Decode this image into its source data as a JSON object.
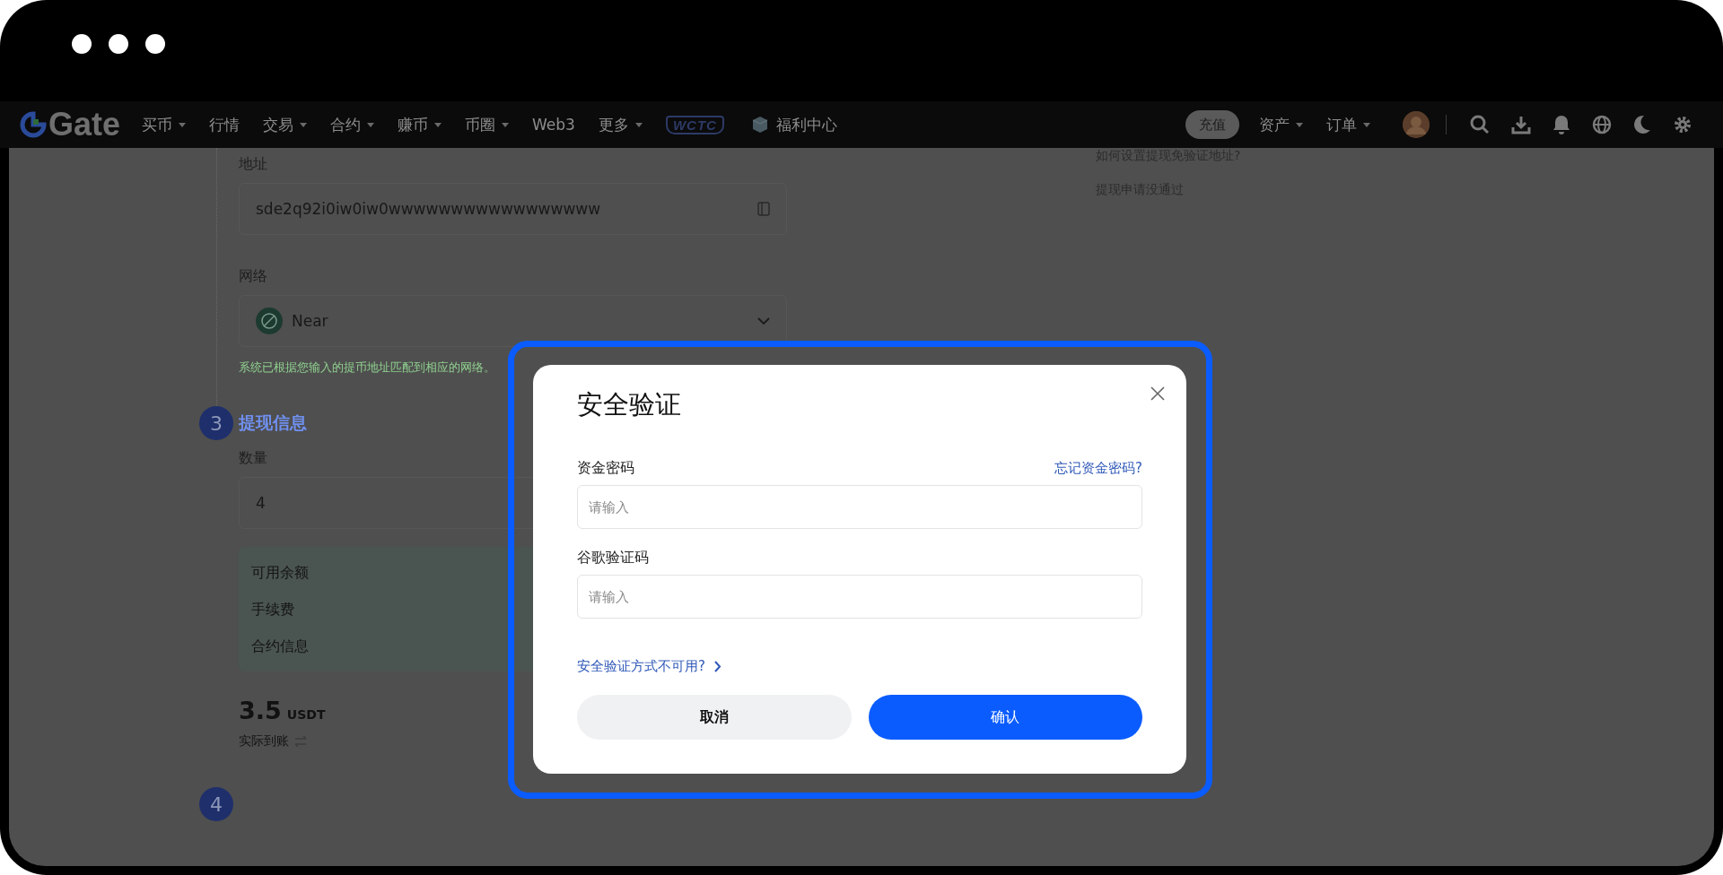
{
  "nav": {
    "logo": "Gate",
    "menu": [
      {
        "label": "买币",
        "dropdown": true
      },
      {
        "label": "行情",
        "dropdown": false
      },
      {
        "label": "交易",
        "dropdown": true
      },
      {
        "label": "合约",
        "dropdown": true
      },
      {
        "label": "赚币",
        "dropdown": true
      },
      {
        "label": "币圈",
        "dropdown": true
      },
      {
        "label": "Web3",
        "dropdown": false
      },
      {
        "label": "更多",
        "dropdown": true
      }
    ],
    "badge_logo": "WCTC",
    "welfare": "福利中心",
    "deposit": "充值",
    "right_menu": [
      {
        "label": "资产",
        "dropdown": true
      },
      {
        "label": "订单",
        "dropdown": true
      }
    ]
  },
  "form": {
    "address": {
      "label": "地址",
      "value": "sde2q92i0iw0iw0wwwwwwwwwwwwwwwww"
    },
    "network": {
      "label": "网络",
      "value": "Near",
      "hint": "系统已根据您输入的提币地址匹配到相应的网络。"
    },
    "step_3": {
      "number": "3",
      "title": "提现信息"
    },
    "amount": {
      "label": "数量",
      "value": "4"
    },
    "balance_rows": [
      "可用余额",
      "手续费",
      "合约信息"
    ],
    "received": {
      "amount": "3.5",
      "unit": "USDT",
      "label": "实际到账"
    },
    "step_4": {
      "number": "4"
    }
  },
  "help": [
    "如何设置提现免验证地址?",
    "提现申请没通过"
  ],
  "modal": {
    "title": "安全验证",
    "fields": [
      {
        "label": "资金密码",
        "placeholder": "请输入",
        "link": "忘记资金密码?"
      },
      {
        "label": "谷歌验证码",
        "placeholder": "请输入"
      }
    ],
    "unavailable_link": "安全验证方式不可用?",
    "buttons": [
      {
        "label": "取消",
        "kind": "secondary"
      },
      {
        "label": "确认",
        "kind": "primary"
      }
    ]
  }
}
